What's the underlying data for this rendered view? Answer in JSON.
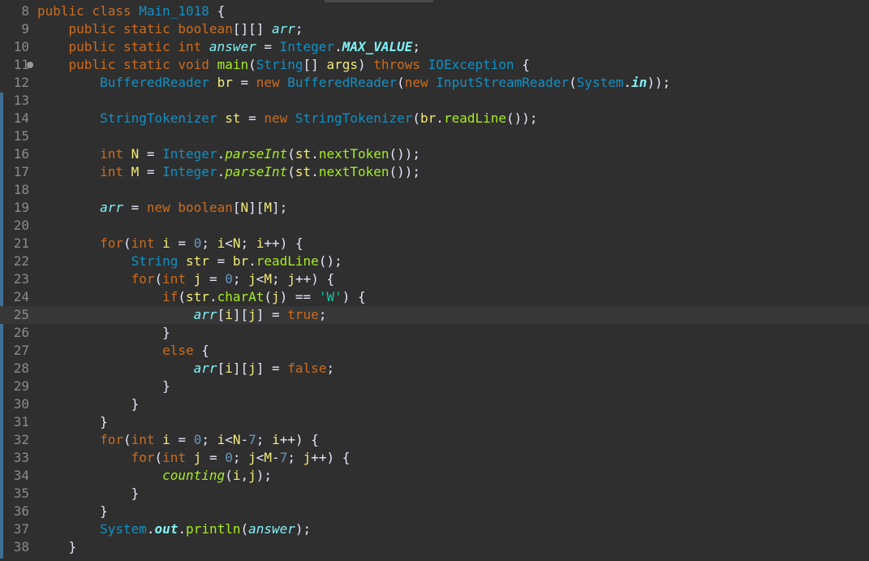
{
  "editor": {
    "class_name": "Main_1018",
    "lines": [
      {
        "num": "8"
      },
      {
        "num": "9"
      },
      {
        "num": "10"
      },
      {
        "num": "11"
      },
      {
        "num": "12"
      },
      {
        "num": "13"
      },
      {
        "num": "14"
      },
      {
        "num": "15"
      },
      {
        "num": "16"
      },
      {
        "num": "17"
      },
      {
        "num": "18"
      },
      {
        "num": "19"
      },
      {
        "num": "20"
      },
      {
        "num": "21"
      },
      {
        "num": "22"
      },
      {
        "num": "23"
      },
      {
        "num": "24"
      },
      {
        "num": "25"
      },
      {
        "num": "26"
      },
      {
        "num": "27"
      },
      {
        "num": "28"
      },
      {
        "num": "29"
      },
      {
        "num": "30"
      },
      {
        "num": "31"
      },
      {
        "num": "32"
      },
      {
        "num": "33"
      },
      {
        "num": "34"
      },
      {
        "num": "35"
      },
      {
        "num": "36"
      },
      {
        "num": "37"
      },
      {
        "num": "38"
      }
    ],
    "current_line": "25",
    "theme_colors": {
      "background": "#2f2f2f",
      "keyword": "#cc6c1d",
      "type": "#1290c3",
      "method": "#a7ec21",
      "field": "#80f2f6",
      "number": "#6897bb",
      "string": "#17c6a3",
      "line_number": "#8b8b8b"
    }
  }
}
